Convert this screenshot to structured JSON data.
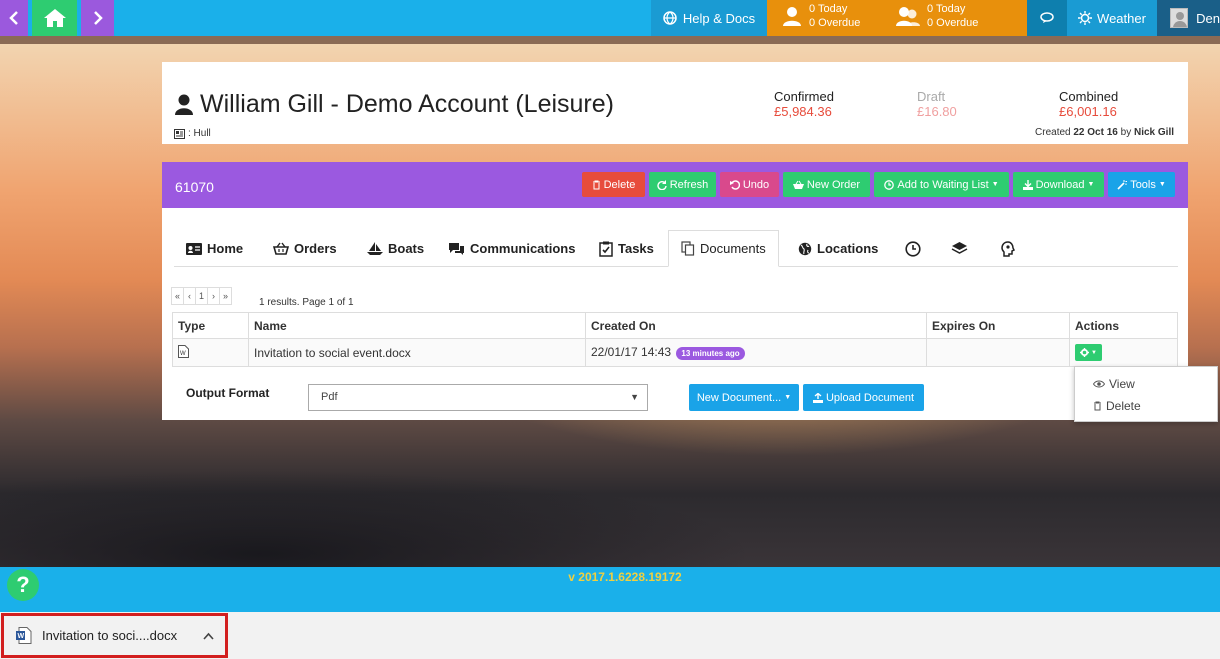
{
  "topbar": {
    "help_label": "Help & Docs",
    "tasks_today": "0 Today",
    "tasks_overdue": "0 Overdue",
    "group_today": "0 Today",
    "group_overdue": "0 Overdue",
    "weather_label": "Weather",
    "user_label": "Den"
  },
  "account": {
    "title": "William Gill - Demo Account (Leisure)",
    "location": ": Hull",
    "confirmed_label": "Confirmed",
    "confirmed_value": "£5,984.36",
    "draft_label": "Draft",
    "draft_value": "£16.80",
    "combined_label": "Combined",
    "combined_value": "£6,001.16",
    "created_prefix": "Created",
    "created_date": "22 Oct 16",
    "created_by_word": "by",
    "created_by": "Nick Gill"
  },
  "order": {
    "number": "61070",
    "buttons": {
      "delete": "Delete",
      "refresh": "Refresh",
      "undo": "Undo",
      "new_order": "New Order",
      "waiting_list": "Add to Waiting List",
      "download": "Download",
      "tools": "Tools"
    },
    "tabs": {
      "home": "Home",
      "orders": "Orders",
      "boats": "Boats",
      "communications": "Communications",
      "tasks": "Tasks",
      "documents": "Documents",
      "locations": "Locations"
    }
  },
  "documents": {
    "pager": [
      "«",
      "‹",
      "1",
      "›",
      "»"
    ],
    "results_text": "1 results. Page 1 of 1",
    "columns": [
      "Type",
      "Name",
      "Created On",
      "Expires On",
      "Actions"
    ],
    "rows": [
      {
        "name": "Invitation to social event.docx",
        "created_on": "22/01/17 14:43",
        "badge": "13 minutes ago",
        "expires_on": ""
      }
    ],
    "output_format_label": "Output Format",
    "output_format_value": "Pdf",
    "new_document_label": "New Document...",
    "upload_document_label": "Upload Document",
    "actions_menu": {
      "view": "View",
      "delete": "Delete"
    }
  },
  "footer": {
    "version": "v 2017.1.6228.19172",
    "help_symbol": "?"
  },
  "download_bar": {
    "file_name": "Invitation to soci....docx"
  },
  "colors": {
    "topbar": "#1ab0ea",
    "purple": "#9b59e0",
    "green": "#2ecc71",
    "orange": "#e8900c",
    "red": "#e74c3c",
    "blue": "#1aa3e8",
    "pink": "#d9498c",
    "money": "#e74c3c"
  }
}
